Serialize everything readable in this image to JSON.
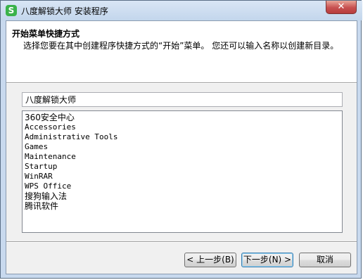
{
  "window": {
    "title": "八度解锁大师 安装程序",
    "app_icon": "S",
    "close_label": "✕"
  },
  "header": {
    "title": "开始菜单快捷方式",
    "description": "选择您要在其中创建程序快捷方式的“开始”菜单。 您还可以输入名称以创建新目录。"
  },
  "folder_name_input": {
    "value": "八度解锁大师"
  },
  "folders": [
    "360安全中心",
    "Accessories",
    "Administrative Tools",
    "Games",
    "Maintenance",
    "Startup",
    "WinRAR",
    "WPS Office",
    "搜狗输入法",
    "腾讯软件"
  ],
  "buttons": {
    "back": "< 上一步(B)",
    "next": "下一步(N) >",
    "cancel": "取消"
  }
}
